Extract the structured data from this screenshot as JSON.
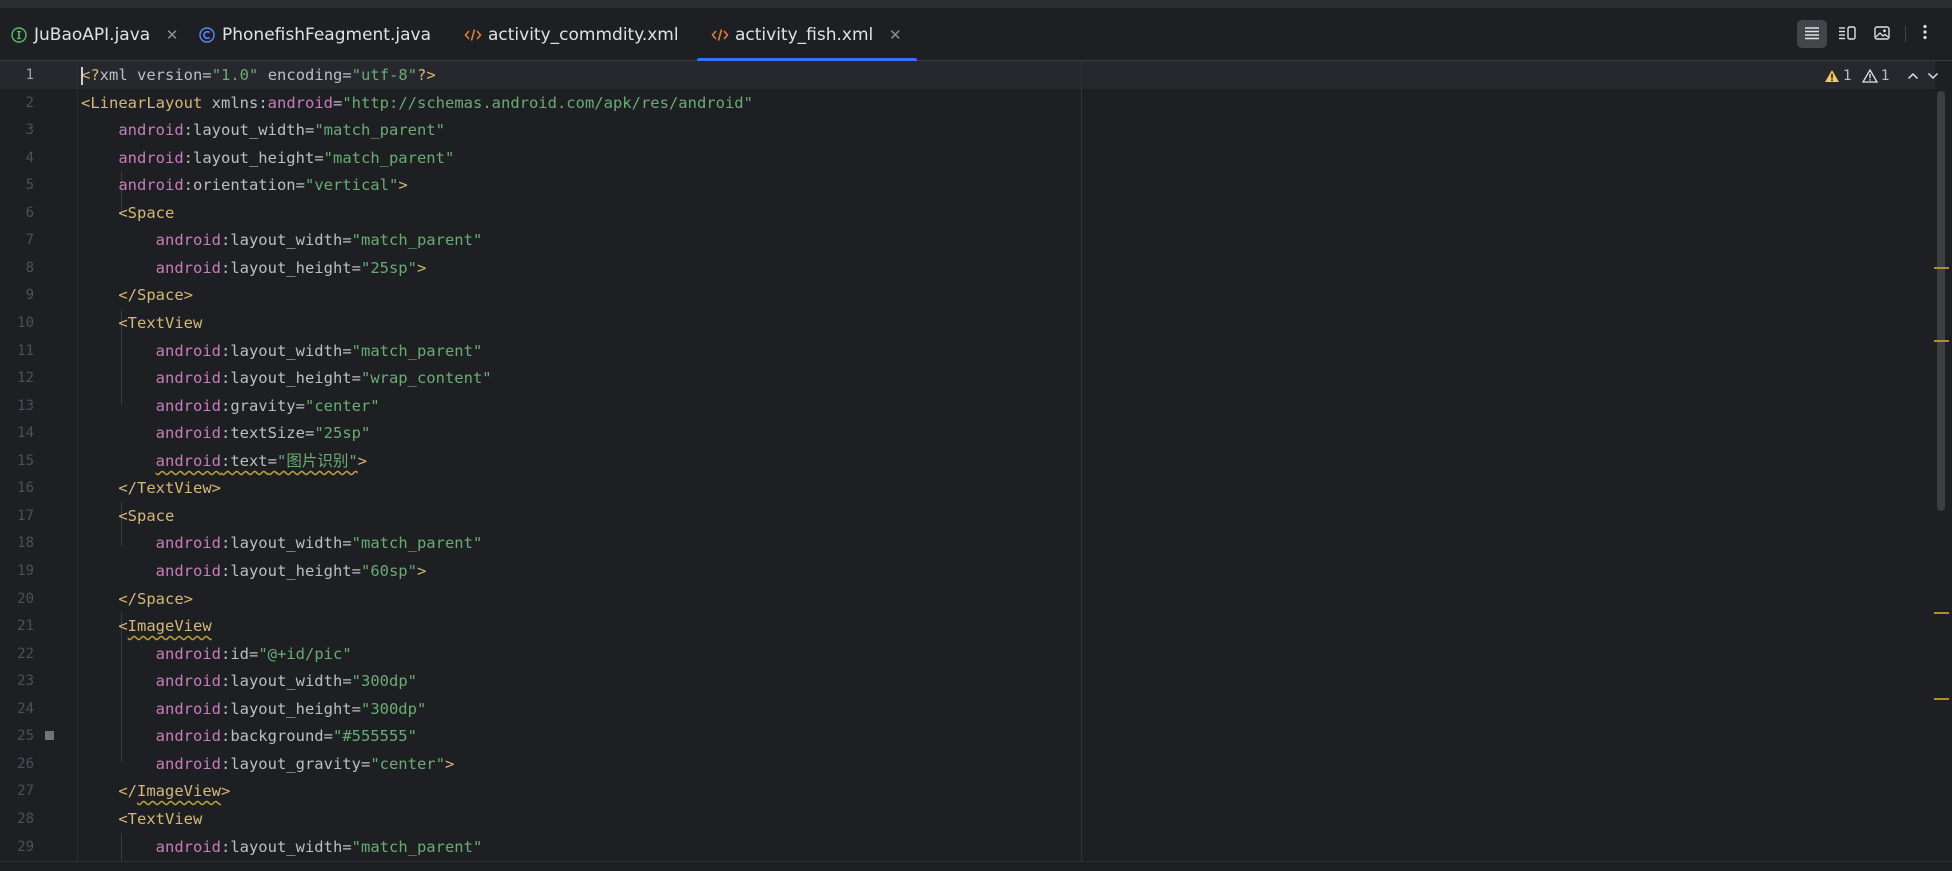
{
  "tabs": [
    {
      "label": "JuBaoAPI.java",
      "icon": "interface-icon",
      "closable": true,
      "active": false
    },
    {
      "label": "PhonefishFeagment.java",
      "icon": "class-icon",
      "closable": false,
      "active": false
    },
    {
      "label": "activity_commdity.xml",
      "icon": "xml-icon",
      "closable": false,
      "active": false
    },
    {
      "label": "activity_fish.xml",
      "icon": "xml-icon",
      "closable": true,
      "active": true
    }
  ],
  "toolbar": {
    "view_modes": [
      "code-view-icon",
      "split-view-icon",
      "design-view-icon"
    ],
    "more": "more-options-icon"
  },
  "inspections": {
    "warnings": "1",
    "weak_warnings": "1"
  },
  "editor": {
    "current_line": 1,
    "line_numbers": [
      "1",
      "2",
      "3",
      "4",
      "5",
      "6",
      "7",
      "8",
      "9",
      "10",
      "11",
      "12",
      "13",
      "14",
      "15",
      "16",
      "17",
      "18",
      "19",
      "20",
      "21",
      "22",
      "23",
      "24",
      "25",
      "26",
      "27",
      "28",
      "29"
    ],
    "lines": [
      "<?xml version=\"1.0\" encoding=\"utf-8\"?>",
      "<LinearLayout xmlns:android=\"http://schemas.android.com/apk/res/android\"",
      "    android:layout_width=\"match_parent\"",
      "    android:layout_height=\"match_parent\"",
      "    android:orientation=\"vertical\">",
      "    <Space",
      "        android:layout_width=\"match_parent\"",
      "        android:layout_height=\"25sp\">",
      "    </Space>",
      "    <TextView",
      "        android:layout_width=\"match_parent\"",
      "        android:layout_height=\"wrap_content\"",
      "        android:gravity=\"center\"",
      "        android:textSize=\"25sp\"",
      "        android:text=\"图片识别\">",
      "    </TextView>",
      "    <Space",
      "        android:layout_width=\"match_parent\"",
      "        android:layout_height=\"60sp\">",
      "    </Space>",
      "    <ImageView",
      "        android:id=\"@+id/pic\"",
      "        android:layout_width=\"300dp\"",
      "        android:layout_height=\"300dp\"",
      "        android:background=\"#555555\"",
      "        android:layout_gravity=\"center\">",
      "    </ImageView>",
      "    <TextView",
      "        android:layout_width=\"match_parent\""
    ]
  },
  "colors": {
    "background": "#1e1f22",
    "tag": "#d5b778",
    "namespace": "#c77dbb",
    "string": "#6aab73",
    "text": "#bcbec4",
    "accent": "#3574f0",
    "warning": "#f2c55c"
  }
}
